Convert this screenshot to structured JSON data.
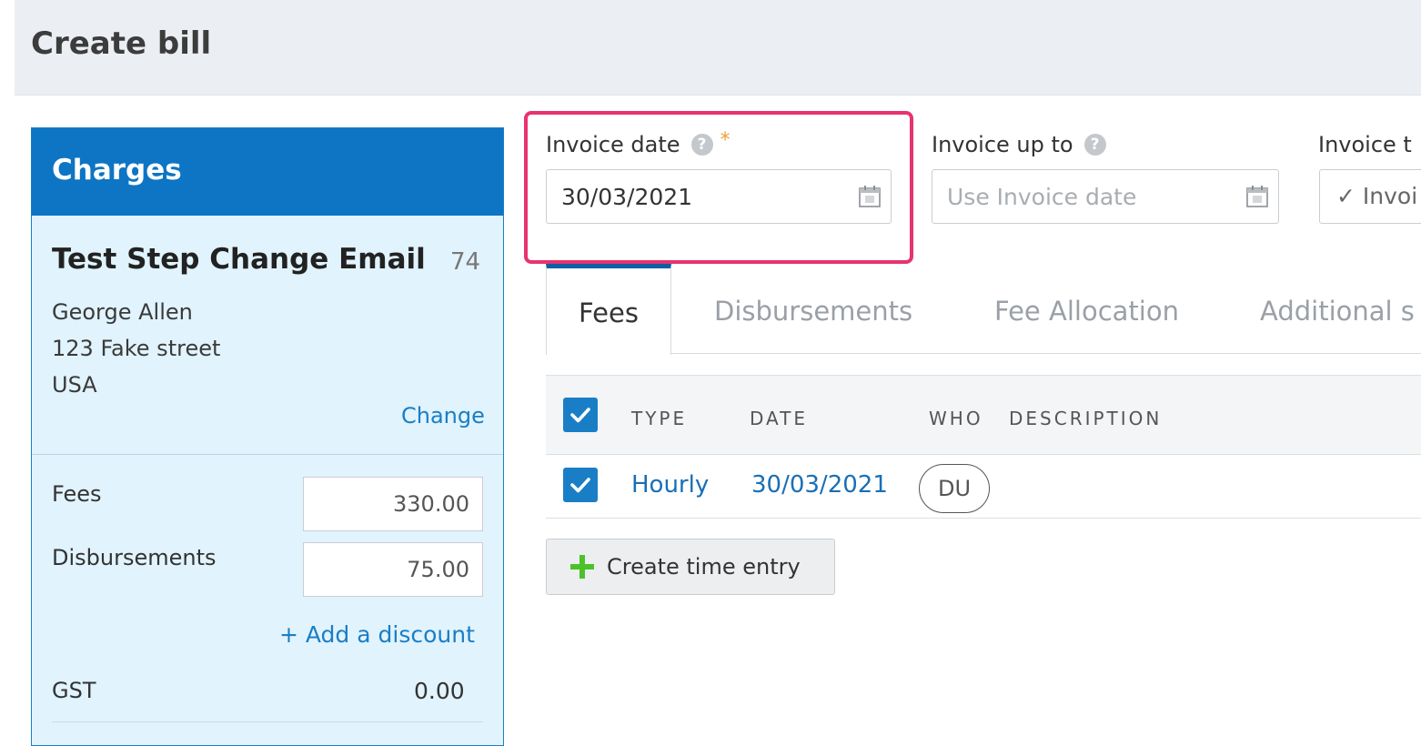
{
  "header": {
    "title": "Create bill"
  },
  "charges": {
    "title": "Charges",
    "matter_name": "Test Step Change Email",
    "matter_number": "74",
    "contact": {
      "name": "George Allen",
      "street": "123 Fake street",
      "country": "USA"
    },
    "change_label": "Change",
    "fees_label": "Fees",
    "fees_value": "330.00",
    "disbursements_label": "Disbursements",
    "disbursements_value": "75.00",
    "add_discount_label": "+ Add a discount",
    "gst_label": "GST",
    "gst_value": "0.00"
  },
  "fields": {
    "invoice_date": {
      "label": "Invoice date",
      "required_mark": "*",
      "value": "30/03/2021",
      "help": "?"
    },
    "invoice_up_to": {
      "label": "Invoice up to",
      "placeholder": "Use Invoice date",
      "help": "?"
    },
    "invoice_template": {
      "label": "Invoice t",
      "value": "✓ Invoi"
    }
  },
  "tabs": [
    {
      "label": "Fees",
      "active": true
    },
    {
      "label": "Disbursements",
      "active": false
    },
    {
      "label": "Fee Allocation",
      "active": false
    },
    {
      "label": "Additional s",
      "active": false
    }
  ],
  "table": {
    "columns": [
      "TYPE",
      "DATE",
      "WHO",
      "DESCRIPTION"
    ],
    "rows": [
      {
        "checked": true,
        "type": "Hourly",
        "date": "30/03/2021",
        "who": "DU",
        "description": ""
      }
    ],
    "header_checked": true
  },
  "actions": {
    "create_time_entry": "Create time entry"
  },
  "colors": {
    "primary": "#0d75c4",
    "link": "#1a7ec6",
    "highlight": "#e8336e",
    "panel_bg": "#e1f3fc",
    "plus_green": "#4cc22a"
  },
  "icons": {
    "calendar": "calendar-icon",
    "help": "help-circle-icon",
    "check": "checkmark-icon",
    "plus": "plus-icon"
  }
}
